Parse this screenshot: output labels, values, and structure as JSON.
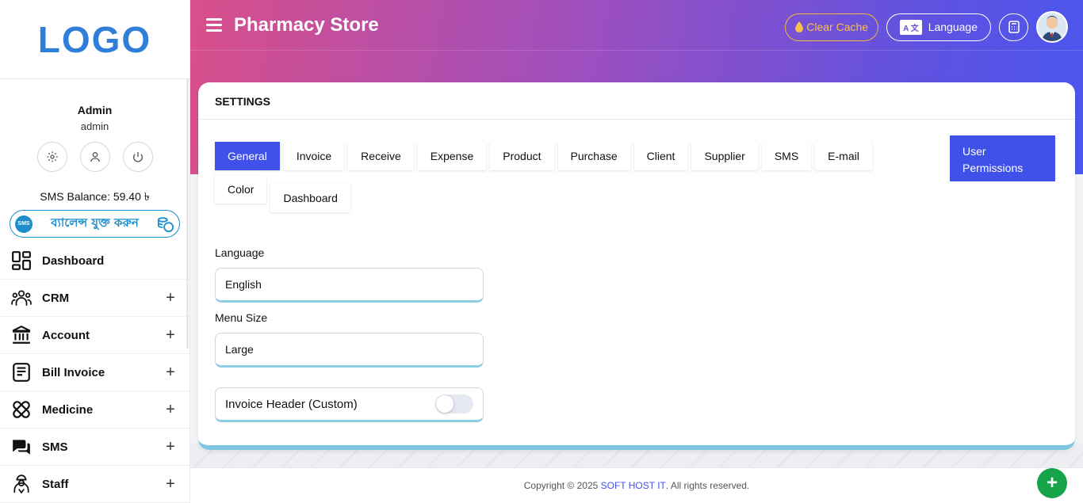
{
  "sidebar": {
    "logo": "LOGO",
    "user": {
      "name": "Admin",
      "role": "admin"
    },
    "sms_balance": "SMS Balance: 59.40 ৳",
    "topup": {
      "badge": "SMS",
      "text": "ব্যালেন্স যুক্ত করুন"
    },
    "items": [
      {
        "label": "Dashboard",
        "icon": "dashboard-grid-icon",
        "expandable": false
      },
      {
        "label": "CRM",
        "icon": "people-group-icon",
        "expandable": true
      },
      {
        "label": "Account",
        "icon": "bank-icon",
        "expandable": true
      },
      {
        "label": "Bill Invoice",
        "icon": "invoice-icon",
        "expandable": true
      },
      {
        "label": "Medicine",
        "icon": "pill-icon",
        "expandable": true
      },
      {
        "label": "SMS",
        "icon": "chat-bubbles-icon",
        "expandable": true
      },
      {
        "label": "Staff",
        "icon": "staff-icon",
        "expandable": true
      }
    ],
    "expand_glyph": "+"
  },
  "header": {
    "title": "Pharmacy Store",
    "clear_cache": "Clear Cache",
    "language": "Language",
    "lang_glyph": "A 文"
  },
  "settings": {
    "title": "SETTINGS",
    "tabs": [
      "General",
      "Invoice",
      "Receive",
      "Expense",
      "Product",
      "Purchase",
      "Client",
      "Supplier",
      "SMS",
      "E-mail",
      "Color",
      "Dashboard"
    ],
    "active_tab": "General",
    "user_permissions": "User Permissions",
    "language_label": "Language",
    "language_value": "English",
    "menu_size_label": "Menu Size",
    "menu_size_value": "Large",
    "invoice_header_label": "Invoice Header (Custom)",
    "invoice_header_enabled": false
  },
  "footer": {
    "prefix": "Copyright © 2025 ",
    "company": "SOFT HOST IT",
    "suffix": ". All rights reserved.",
    "fab": "+"
  },
  "colors": {
    "primary": "#3f51e8",
    "brand_blue": "#2f7fd8",
    "sms_blue": "#1c8ec9",
    "cache_orange": "#f4b740",
    "fab_green": "#16a34a"
  }
}
